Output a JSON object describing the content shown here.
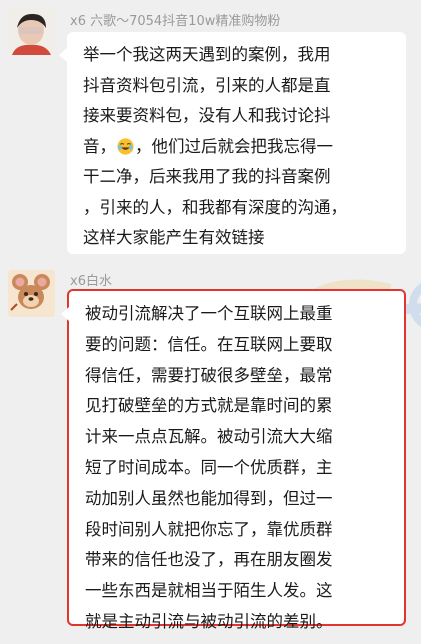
{
  "messages": [
    {
      "sender": "x6 六歌～7054抖音10w精准购物粉",
      "avatar_icon": "user-avatar-icon",
      "lines": [
        "举一个我这两天遇到的案例，我用",
        "抖音资料包引流，引来的人都是直",
        "接来要资料包，没有人和我讨论抖",
        [
          "音，",
          "[laugh-cry-emoji]",
          "，他们过后就会把我忘得一"
        ],
        "干二净，后来我用了我的抖音案例",
        "，引来的人，和我都有深度的沟通，",
        "这样大家能产生有效链接"
      ]
    },
    {
      "sender": "x6白水",
      "avatar_icon": "cartoon-mouse-avatar-icon",
      "lines": [
        "被动引流解决了一个互联网上最重",
        "要的问题：信任。在互联网上要取",
        "得信任，需要打破很多壁垒，最常",
        "见打破壁垒的方式就是靠时间的累",
        "计来一点点瓦解。被动引流大大缩",
        "短了时间成本。同一个优质群，主",
        "动加别人虽然也能加得到，但过一",
        "段时间别人就把你忘了，靠优质群",
        "带来的信任也没了，再在朋友圈发",
        "一些东西是就相当于陌生人发。这",
        "就是主动引流与被动引流的差别。"
      ],
      "highlight_color": "#e0362f"
    }
  ]
}
